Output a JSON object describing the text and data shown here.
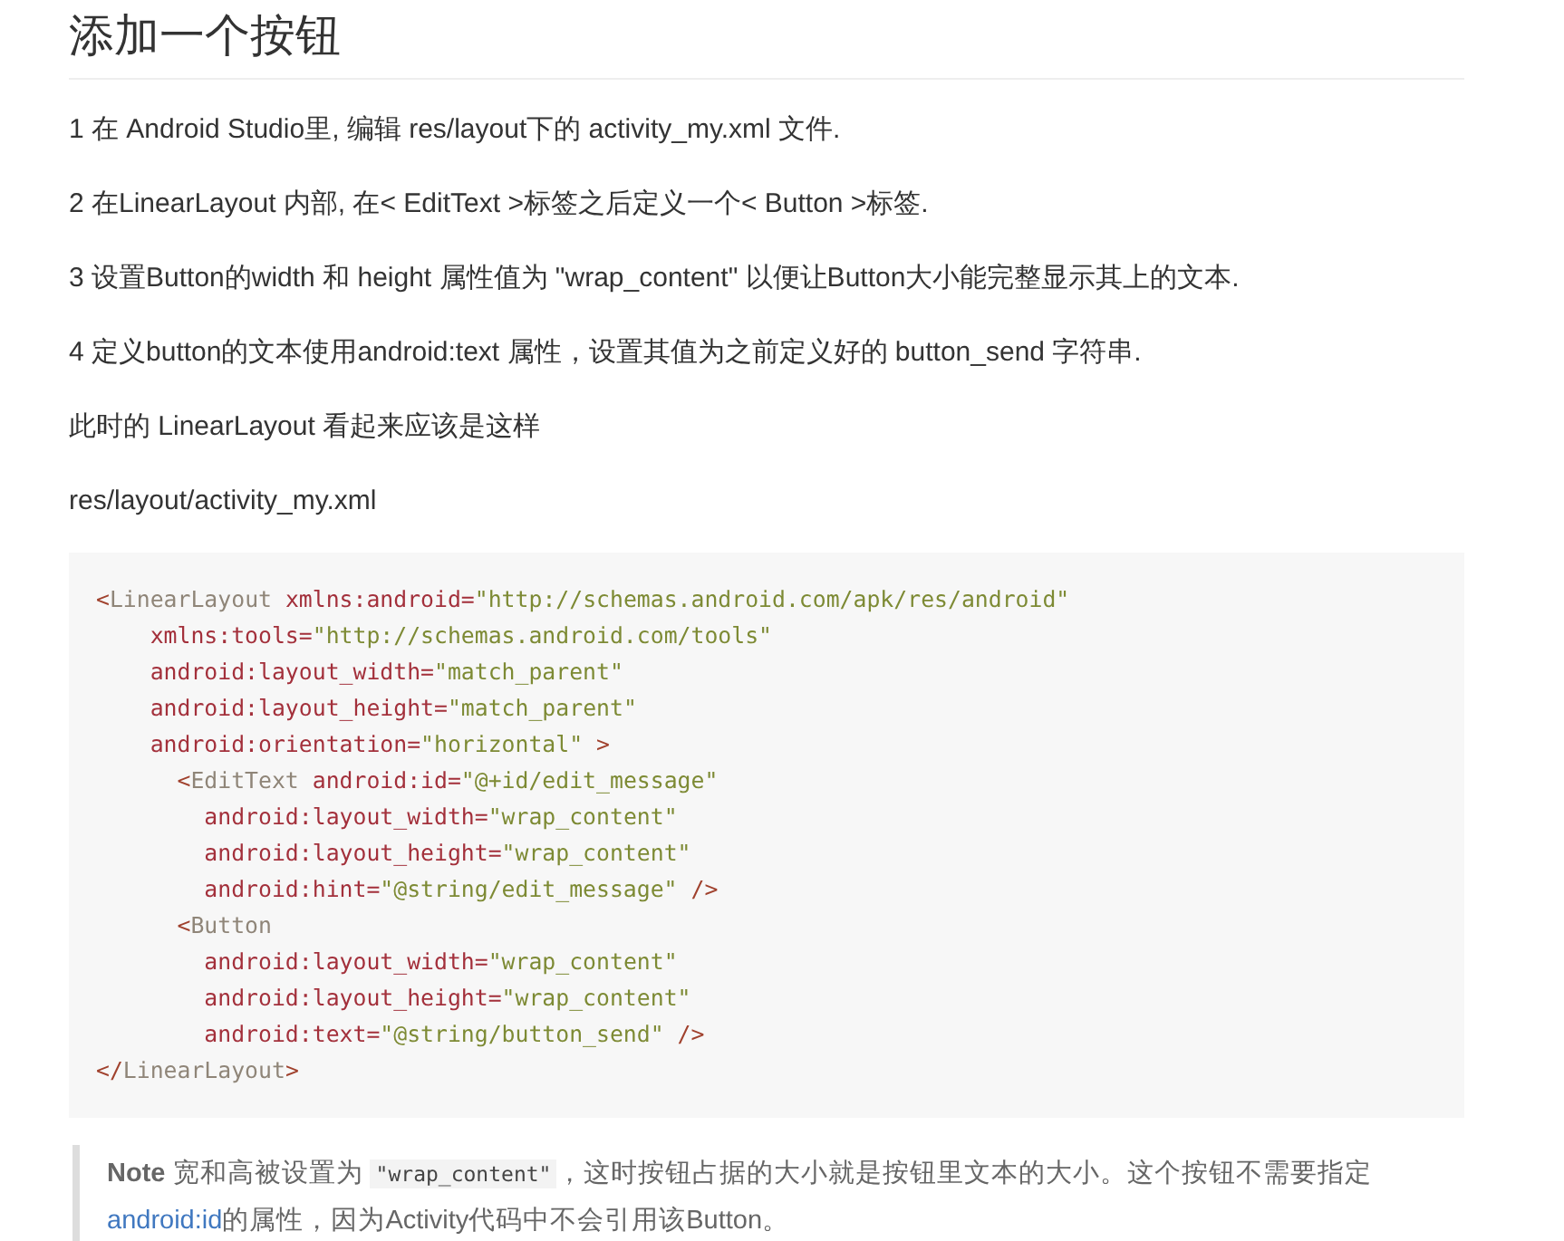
{
  "heading": "添加一个按钮",
  "paragraphs": [
    "1 在 Android Studio里, 编辑 res/layout下的 activity_my.xml 文件.",
    "2 在LinearLayout 内部, 在< EditText >标签之后定义一个< Button >标签.",
    "3 设置Button的width 和 height 属性值为 \"wrap_content\" 以便让Button大小能完整显示其上的文本.",
    "4 定义button的文本使用android:text 属性，设置其值为之前定义好的 button_send 字符串.",
    "此时的 LinearLayout 看起来应该是这样",
    "res/layout/activity_my.xml"
  ],
  "code_lines": [
    [
      {
        "kind": "punct",
        "text": "<"
      },
      {
        "kind": "tag",
        "text": "LinearLayout "
      },
      {
        "kind": "attr",
        "text": "xmlns:android="
      },
      {
        "kind": "value",
        "text": "\"http://schemas.android.com/apk/res/android\""
      }
    ],
    [
      {
        "kind": "attr",
        "text": "    xmlns:tools="
      },
      {
        "kind": "value",
        "text": "\"http://schemas.android.com/tools\""
      }
    ],
    [
      {
        "kind": "attr",
        "text": "    android:layout_width="
      },
      {
        "kind": "value",
        "text": "\"match_parent\""
      }
    ],
    [
      {
        "kind": "attr",
        "text": "    android:layout_height="
      },
      {
        "kind": "value",
        "text": "\"match_parent\""
      }
    ],
    [
      {
        "kind": "attr",
        "text": "    android:orientation="
      },
      {
        "kind": "value",
        "text": "\"horizontal\""
      },
      {
        "kind": "punct",
        "text": " >"
      }
    ],
    [
      {
        "kind": "punct",
        "text": "      <"
      },
      {
        "kind": "tag",
        "text": "EditText "
      },
      {
        "kind": "attr",
        "text": "android:id="
      },
      {
        "kind": "value",
        "text": "\"@+id/edit_message\""
      }
    ],
    [
      {
        "kind": "attr",
        "text": "        android:layout_width="
      },
      {
        "kind": "value",
        "text": "\"wrap_content\""
      }
    ],
    [
      {
        "kind": "attr",
        "text": "        android:layout_height="
      },
      {
        "kind": "value",
        "text": "\"wrap_content\""
      }
    ],
    [
      {
        "kind": "attr",
        "text": "        android:hint="
      },
      {
        "kind": "value",
        "text": "\"@string/edit_message\""
      },
      {
        "kind": "punct",
        "text": " />"
      }
    ],
    [
      {
        "kind": "punct",
        "text": "      <"
      },
      {
        "kind": "tag",
        "text": "Button"
      }
    ],
    [
      {
        "kind": "attr",
        "text": "        android:layout_width="
      },
      {
        "kind": "value",
        "text": "\"wrap_content\""
      }
    ],
    [
      {
        "kind": "attr",
        "text": "        android:layout_height="
      },
      {
        "kind": "value",
        "text": "\"wrap_content\""
      }
    ],
    [
      {
        "kind": "attr",
        "text": "        android:text="
      },
      {
        "kind": "value",
        "text": "\"@string/button_send\""
      },
      {
        "kind": "punct",
        "text": " />"
      }
    ],
    [
      {
        "kind": "punct",
        "text": "</"
      },
      {
        "kind": "tag",
        "text": "LinearLayout"
      },
      {
        "kind": "punct",
        "text": ">"
      }
    ]
  ],
  "note": [
    {
      "kind": "text",
      "text": "**Note** 宽和高被设置为 "
    },
    {
      "kind": "code",
      "text": "\"wrap_content\""
    },
    {
      "kind": "text",
      "text": "，这时按钮占据的大小就是按钮里文本的大小。这个按钮不需要指定"
    },
    {
      "kind": "link",
      "text": "android:id"
    },
    {
      "kind": "text",
      "text": "的属性，因为Activity代码中不会引用该Button。"
    }
  ]
}
